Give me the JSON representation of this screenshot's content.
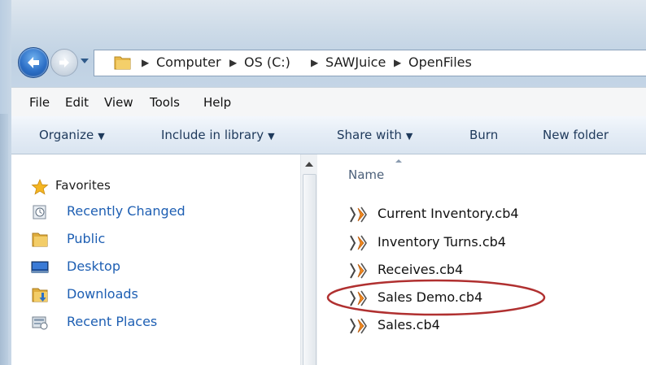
{
  "nav": {
    "back_icon": "back-arrow-icon",
    "forward_icon": "forward-arrow-icon",
    "history_icon": "chevron-down-icon"
  },
  "address_bar": {
    "folder_icon": "folder-icon",
    "breadcrumbs": [
      "Computer",
      "OS (C:)",
      "SAWJuice",
      "OpenFiles"
    ]
  },
  "menu": {
    "items": [
      "File",
      "Edit",
      "View",
      "Tools",
      "Help"
    ]
  },
  "toolbar": {
    "organize": "Organize",
    "include_in_library": "Include in library",
    "share_with": "Share with",
    "burn": "Burn",
    "new_folder": "New folder"
  },
  "sidebar": {
    "favorites_label": "Favorites",
    "favorites_icon": "star-icon",
    "items": [
      {
        "label": "Recently Changed",
        "icon": "recent-changes-icon"
      },
      {
        "label": "Public",
        "icon": "folder-icon"
      },
      {
        "label": "Desktop",
        "icon": "desktop-icon"
      },
      {
        "label": "Downloads",
        "icon": "downloads-folder-icon"
      },
      {
        "label": "Recent Places",
        "icon": "recent-places-icon"
      }
    ]
  },
  "file_list": {
    "column_name": "Name",
    "files": [
      {
        "name": "Current Inventory.cb4",
        "icon": "cb4-file-icon"
      },
      {
        "name": "Inventory Turns.cb4",
        "icon": "cb4-file-icon"
      },
      {
        "name": "Receives.cb4",
        "icon": "cb4-file-icon"
      },
      {
        "name": "Sales Demo.cb4",
        "icon": "cb4-file-icon",
        "highlighted": true
      },
      {
        "name": "Sales.cb4",
        "icon": "cb4-file-icon"
      }
    ]
  },
  "colors": {
    "link_blue": "#1e5fb3",
    "highlight_ellipse": "#b03030",
    "toolbar_text": "#1e395b"
  }
}
